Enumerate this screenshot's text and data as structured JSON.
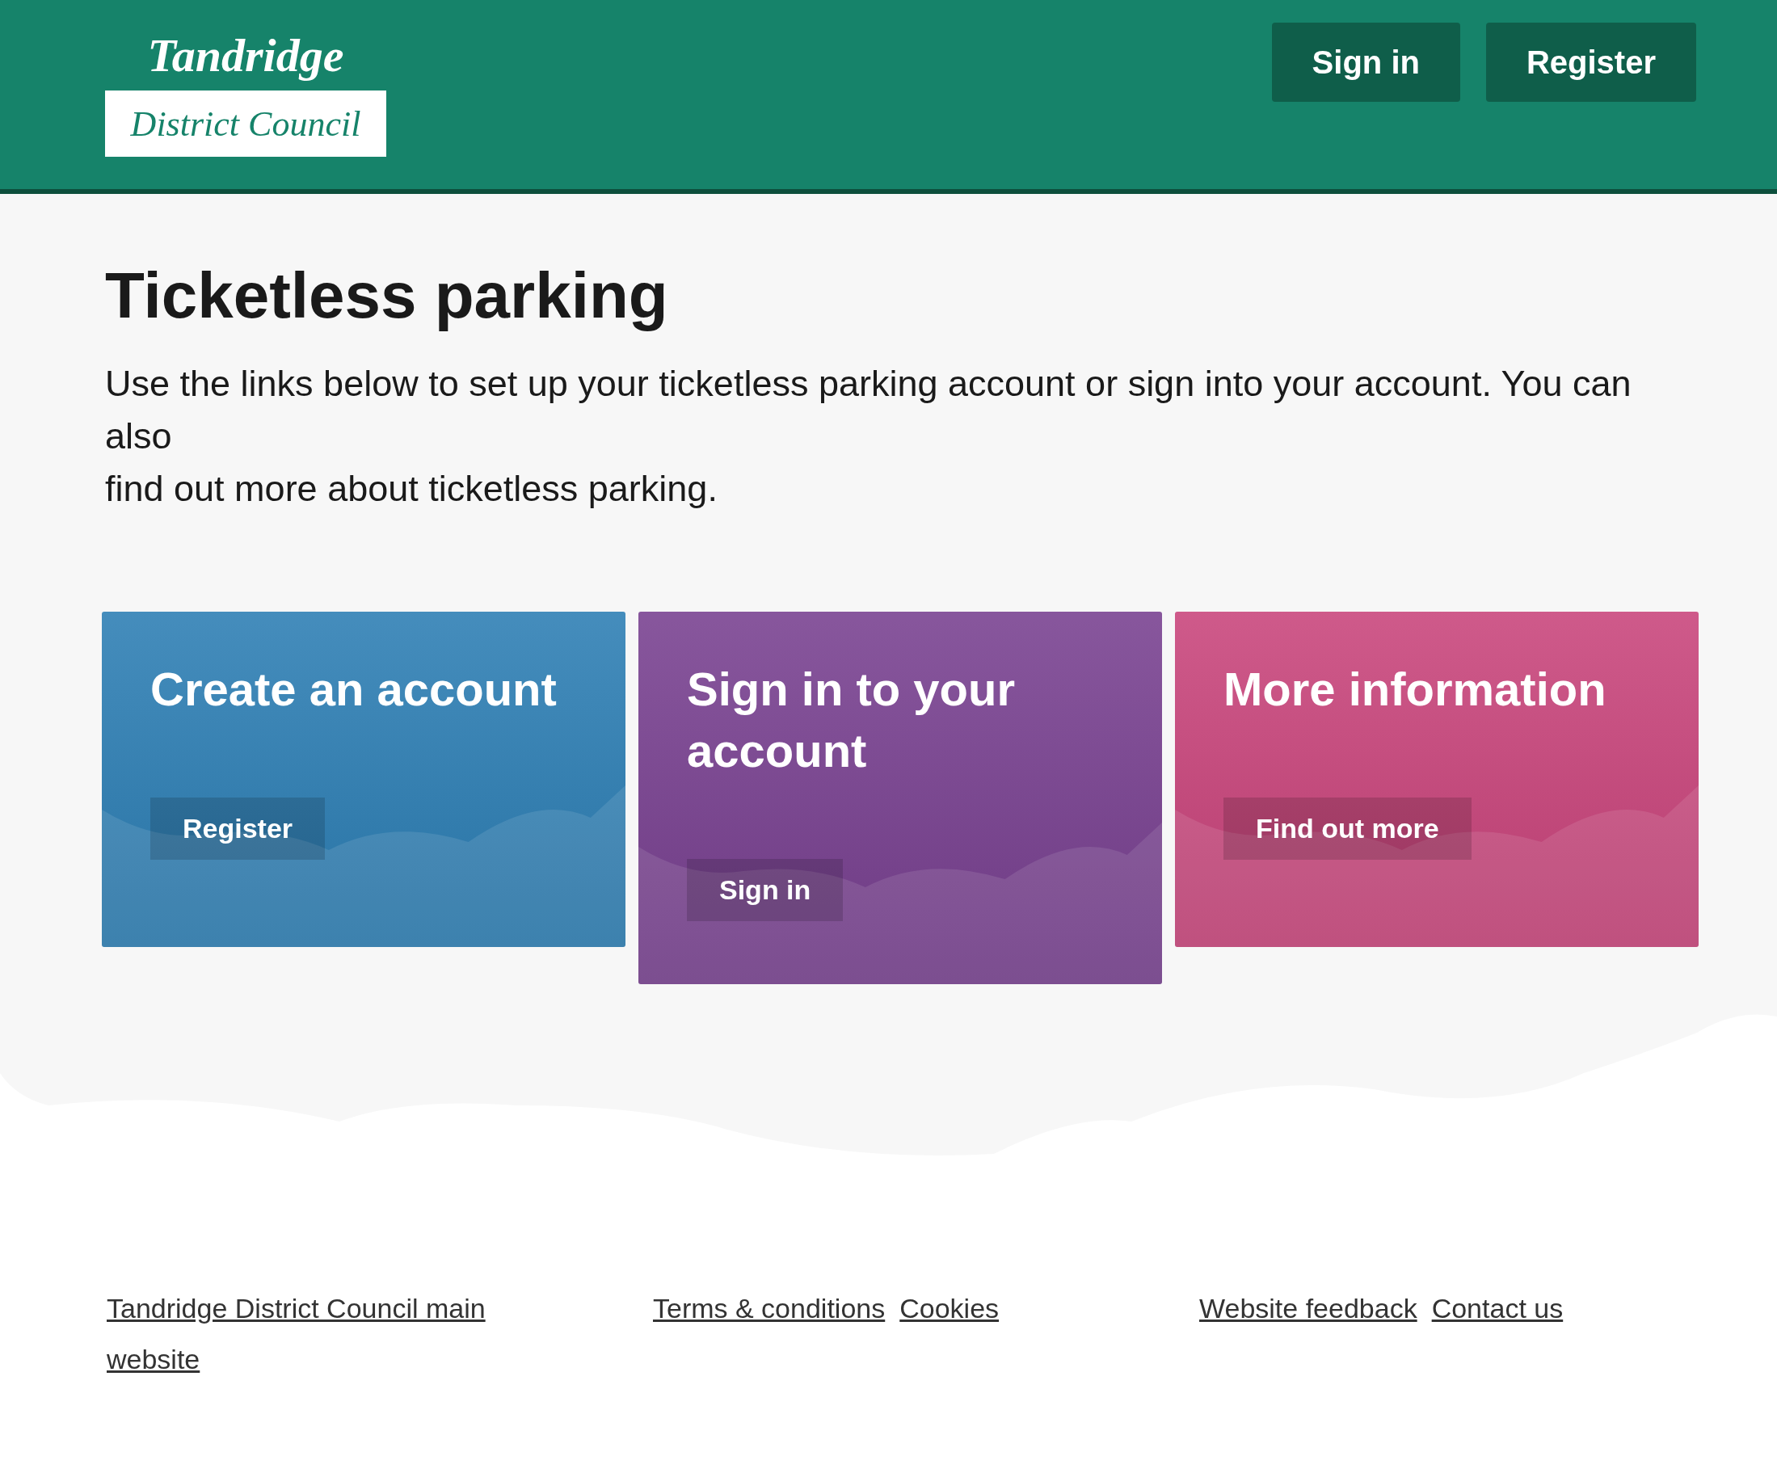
{
  "header": {
    "logo": {
      "top": "Tandridge",
      "bottom": "District Council"
    },
    "buttons": [
      "Sign in",
      "Register"
    ]
  },
  "title": "Ticketless parking",
  "intro": [
    "Use the links below to set up your ticketless parking account or sign into your account. You can also",
    "find out more about ticketless parking."
  ],
  "cards": [
    {
      "title": "Create an account",
      "button": "Register",
      "color": "#2b7db3"
    },
    {
      "title": "Sign in to your account",
      "button": "Sign in",
      "color": "#773f8f"
    },
    {
      "title": "More information",
      "button": "Find out more",
      "color": "#c8437a"
    }
  ],
  "footer": {
    "columns": [
      [
        "Tandridge District Council main website"
      ],
      [
        "Terms & conditions",
        "Cookies"
      ],
      [
        "Website feedback",
        "Contact us"
      ]
    ]
  }
}
